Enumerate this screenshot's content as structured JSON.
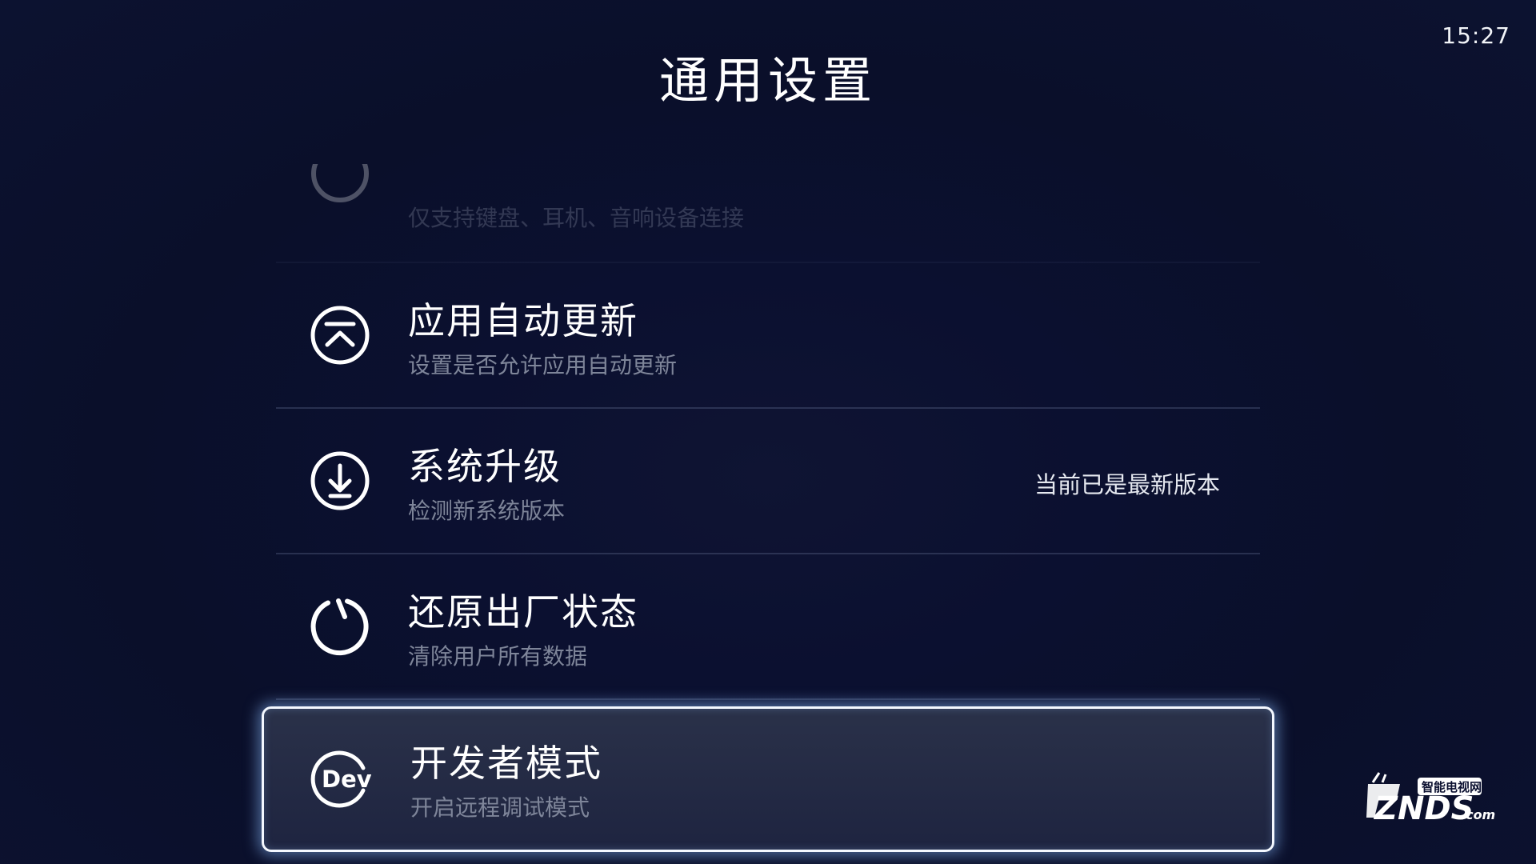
{
  "status_bar": {
    "time": "15:27"
  },
  "header": {
    "title": "通用设置"
  },
  "settings": {
    "items": [
      {
        "icon": "connect-icon",
        "title": "",
        "subtitle": "仅支持键盘、耳机、音响设备连接",
        "status": ""
      },
      {
        "icon": "auto-update-icon",
        "title": "应用自动更新",
        "subtitle": "设置是否允许应用自动更新",
        "status": ""
      },
      {
        "icon": "download-icon",
        "title": "系统升级",
        "subtitle": "检测新系统版本",
        "status": "当前已是最新版本"
      },
      {
        "icon": "power-reset-icon",
        "title": "还原出厂状态",
        "subtitle": "清除用户所有数据",
        "status": ""
      },
      {
        "icon": "dev-icon",
        "title": "开发者模式",
        "subtitle": "开启远程调试模式",
        "status": "",
        "selected": true
      }
    ]
  },
  "watermark": {
    "top_text": "智能电视网",
    "brand": "ZNDS",
    "suffix": ".com"
  },
  "colors": {
    "background": "#0b1030",
    "divider": "#3a4260",
    "subtitle": "#7e8599",
    "focus_glow": "#8cbeff"
  }
}
